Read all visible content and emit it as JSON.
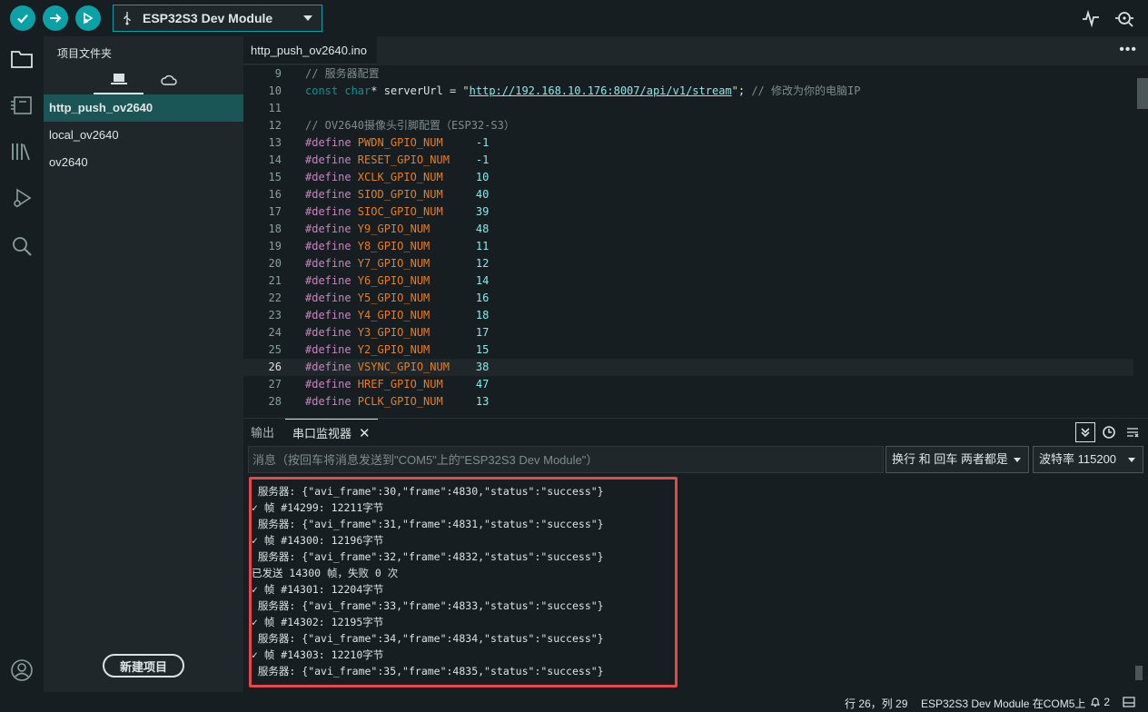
{
  "toolbar": {
    "verify_label": "Verify",
    "upload_label": "Upload",
    "debug_label": "Debug",
    "board": "ESP32S3 Dev Module",
    "accent": "#0ca1a6"
  },
  "sidebar": {
    "title": "项目文件夹",
    "new_project": "新建项目",
    "sketches": [
      "http_push_ov2640",
      "local_ov2640",
      "ov2640"
    ]
  },
  "editor": {
    "tab": "http_push_ov2640.ino",
    "current_line": 26,
    "lines": [
      {
        "n": "9",
        "parts": [
          {
            "t": "// 服务器配置",
            "c": "c-com"
          }
        ]
      },
      {
        "n": "10",
        "parts": [
          {
            "t": "const",
            "c": "c-kw"
          },
          {
            "t": " ",
            "c": "c-plain"
          },
          {
            "t": "char",
            "c": "c-kw"
          },
          {
            "t": "* serverUrl = ",
            "c": "c-plain"
          },
          {
            "t": "\"",
            "c": "c-str"
          },
          {
            "t": "http://192.168.10.176:8007/api/v1/stream",
            "c": "c-url"
          },
          {
            "t": "\"",
            "c": "c-str"
          },
          {
            "t": "; ",
            "c": "c-plain"
          },
          {
            "t": "// 修改为你的电脑IP",
            "c": "c-com"
          }
        ]
      },
      {
        "n": "11",
        "parts": []
      },
      {
        "n": "12",
        "parts": [
          {
            "t": "// OV2640摄像头引脚配置（ESP32-S3）",
            "c": "c-com"
          }
        ]
      },
      {
        "n": "13",
        "parts": [
          {
            "t": "#define",
            "c": "c-def"
          },
          {
            "t": " PWDN_GPIO_NUM",
            "c": "c-mac"
          },
          {
            "t": "     -1",
            "c": "c-num"
          }
        ]
      },
      {
        "n": "14",
        "parts": [
          {
            "t": "#define",
            "c": "c-def"
          },
          {
            "t": " RESET_GPIO_NUM",
            "c": "c-mac"
          },
          {
            "t": "    -1",
            "c": "c-num"
          }
        ]
      },
      {
        "n": "15",
        "parts": [
          {
            "t": "#define",
            "c": "c-def"
          },
          {
            "t": " XCLK_GPIO_NUM",
            "c": "c-mac"
          },
          {
            "t": "     10",
            "c": "c-num"
          }
        ]
      },
      {
        "n": "16",
        "parts": [
          {
            "t": "#define",
            "c": "c-def"
          },
          {
            "t": " SIOD_GPIO_NUM",
            "c": "c-mac"
          },
          {
            "t": "     40",
            "c": "c-num"
          }
        ]
      },
      {
        "n": "17",
        "parts": [
          {
            "t": "#define",
            "c": "c-def"
          },
          {
            "t": " SIOC_GPIO_NUM",
            "c": "c-mac"
          },
          {
            "t": "     39",
            "c": "c-num"
          }
        ]
      },
      {
        "n": "18",
        "parts": [
          {
            "t": "#define",
            "c": "c-def"
          },
          {
            "t": " Y9_GPIO_NUM",
            "c": "c-mac"
          },
          {
            "t": "       48",
            "c": "c-num"
          }
        ]
      },
      {
        "n": "19",
        "parts": [
          {
            "t": "#define",
            "c": "c-def"
          },
          {
            "t": " Y8_GPIO_NUM",
            "c": "c-mac"
          },
          {
            "t": "       11",
            "c": "c-num"
          }
        ]
      },
      {
        "n": "20",
        "parts": [
          {
            "t": "#define",
            "c": "c-def"
          },
          {
            "t": " Y7_GPIO_NUM",
            "c": "c-mac"
          },
          {
            "t": "       12",
            "c": "c-num"
          }
        ]
      },
      {
        "n": "21",
        "parts": [
          {
            "t": "#define",
            "c": "c-def"
          },
          {
            "t": " Y6_GPIO_NUM",
            "c": "c-mac"
          },
          {
            "t": "       14",
            "c": "c-num"
          }
        ]
      },
      {
        "n": "22",
        "parts": [
          {
            "t": "#define",
            "c": "c-def"
          },
          {
            "t": " Y5_GPIO_NUM",
            "c": "c-mac"
          },
          {
            "t": "       16",
            "c": "c-num"
          }
        ]
      },
      {
        "n": "23",
        "parts": [
          {
            "t": "#define",
            "c": "c-def"
          },
          {
            "t": " Y4_GPIO_NUM",
            "c": "c-mac"
          },
          {
            "t": "       18",
            "c": "c-num"
          }
        ]
      },
      {
        "n": "24",
        "parts": [
          {
            "t": "#define",
            "c": "c-def"
          },
          {
            "t": " Y3_GPIO_NUM",
            "c": "c-mac"
          },
          {
            "t": "       17",
            "c": "c-num"
          }
        ]
      },
      {
        "n": "25",
        "parts": [
          {
            "t": "#define",
            "c": "c-def"
          },
          {
            "t": " Y2_GPIO_NUM",
            "c": "c-mac"
          },
          {
            "t": "       15",
            "c": "c-num"
          }
        ]
      },
      {
        "n": "26",
        "parts": [
          {
            "t": "#define",
            "c": "c-def"
          },
          {
            "t": " VSYNC_GPIO_NUM",
            "c": "c-mac"
          },
          {
            "t": "    38",
            "c": "c-num"
          }
        ]
      },
      {
        "n": "27",
        "parts": [
          {
            "t": "#define",
            "c": "c-def"
          },
          {
            "t": " HREF_GPIO_NUM",
            "c": "c-mac"
          },
          {
            "t": "     47",
            "c": "c-num"
          }
        ]
      },
      {
        "n": "28",
        "parts": [
          {
            "t": "#define",
            "c": "c-def"
          },
          {
            "t": " PCLK_GPIO_NUM",
            "c": "c-mac"
          },
          {
            "t": "     13",
            "c": "c-num"
          }
        ]
      }
    ]
  },
  "panel": {
    "tab_output": "输出",
    "tab_serial": "串口监视器",
    "close": "✕",
    "message_placeholder": "消息（按回车将消息发送到\"COM5\"上的\"ESP32S3 Dev Module\"）",
    "line_ending": "换行 和 回车 两者都是",
    "baud": "波特率 115200",
    "serial_lines": [
      " 服务器: {\"avi_frame\":30,\"frame\":4830,\"status\":\"success\"}",
      "✓ 帧 #14299: 12211字节",
      " 服务器: {\"avi_frame\":31,\"frame\":4831,\"status\":\"success\"}",
      "✓ 帧 #14300: 12196字节",
      " 服务器: {\"avi_frame\":32,\"frame\":4832,\"status\":\"success\"}",
      "已发送 14300 帧，失败 0 次",
      "✓ 帧 #14301: 12204字节",
      " 服务器: {\"avi_frame\":33,\"frame\":4833,\"status\":\"success\"}",
      "✓ 帧 #14302: 12195字节",
      " 服务器: {\"avi_frame\":34,\"frame\":4834,\"status\":\"success\"}",
      "✓ 帧 #14303: 12210字节",
      " 服务器: {\"avi_frame\":35,\"frame\":4835,\"status\":\"success\"}"
    ]
  },
  "status": {
    "position": "行 26，列 29",
    "board_port": "ESP32S3 Dev Module 在COM5上",
    "notifications": "2"
  }
}
